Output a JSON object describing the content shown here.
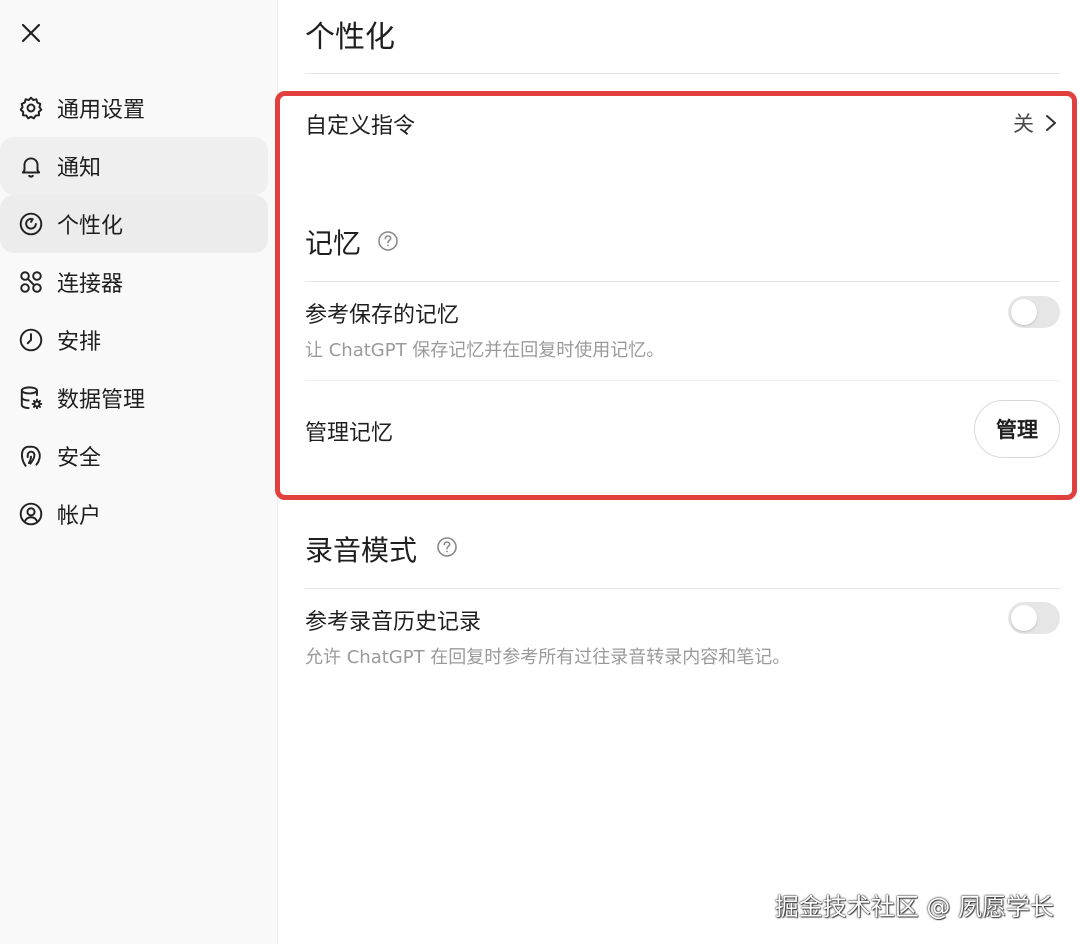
{
  "sidebar": {
    "items": [
      {
        "label": "通用设置",
        "icon": "gear-icon"
      },
      {
        "label": "通知",
        "icon": "bell-icon"
      },
      {
        "label": "个性化",
        "icon": "personalization-icon"
      },
      {
        "label": "连接器",
        "icon": "connectors-icon"
      },
      {
        "label": "安排",
        "icon": "clock-icon"
      },
      {
        "label": "数据管理",
        "icon": "database-icon"
      },
      {
        "label": "安全",
        "icon": "security-icon"
      },
      {
        "label": "帐户",
        "icon": "account-icon"
      }
    ],
    "active_index": 2
  },
  "main": {
    "title": "个性化",
    "custom_instructions": {
      "label": "自定义指令",
      "status": "关"
    },
    "memory": {
      "title": "记忆",
      "reference_saved": {
        "label": "参考保存的记忆",
        "description": "让 ChatGPT 保存记忆并在回复时使用记忆。",
        "enabled": false
      },
      "manage": {
        "label": "管理记忆",
        "button": "管理"
      }
    },
    "voice": {
      "title": "录音模式",
      "reference_history": {
        "label": "参考录音历史记录",
        "description": "允许 ChatGPT 在回复时参考所有过往录音转录内容和笔记。",
        "enabled": false
      }
    }
  },
  "watermark": "掘金技术社区 @ 夙愿学长",
  "colors": {
    "highlight": "#e2403f",
    "sidebar_bg": "#f9f9f9"
  }
}
